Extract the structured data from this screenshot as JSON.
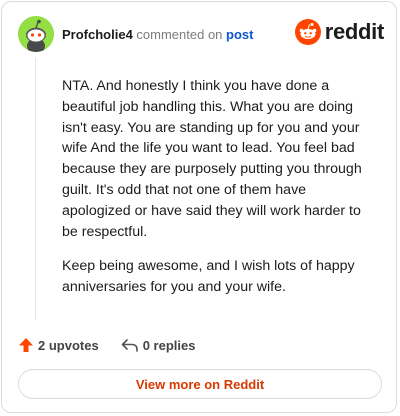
{
  "comment": {
    "username": "Profcholie4",
    "action_text": "commented on",
    "target_link": "post",
    "paragraphs": [
      "NTA. And honestly I think you have done a beautiful job handling this. What you are doing isn't easy. You are standing up for you and your wife And the life you want to lead. You feel bad because they are purposely putting you through guilt. It's odd that not one of them have apologized or have said they will work harder to be respectful.",
      "Keep being awesome, and I wish lots of happy anniversaries for you and your wife."
    ]
  },
  "brand": {
    "wordmark": "reddit",
    "icon": "reddit-snoo-icon",
    "color": "#ff4500"
  },
  "actions": {
    "upvotes_label": "2 upvotes",
    "upvote_icon": "upvote-arrow-icon",
    "replies_label": "0 replies",
    "reply_icon": "reply-arrow-icon"
  },
  "cta": {
    "label": "View more on Reddit",
    "color": "#d93900"
  },
  "colors": {
    "avatar_bg": "#94e044",
    "link": "#0b57d0",
    "upvote": "#ff4500"
  }
}
